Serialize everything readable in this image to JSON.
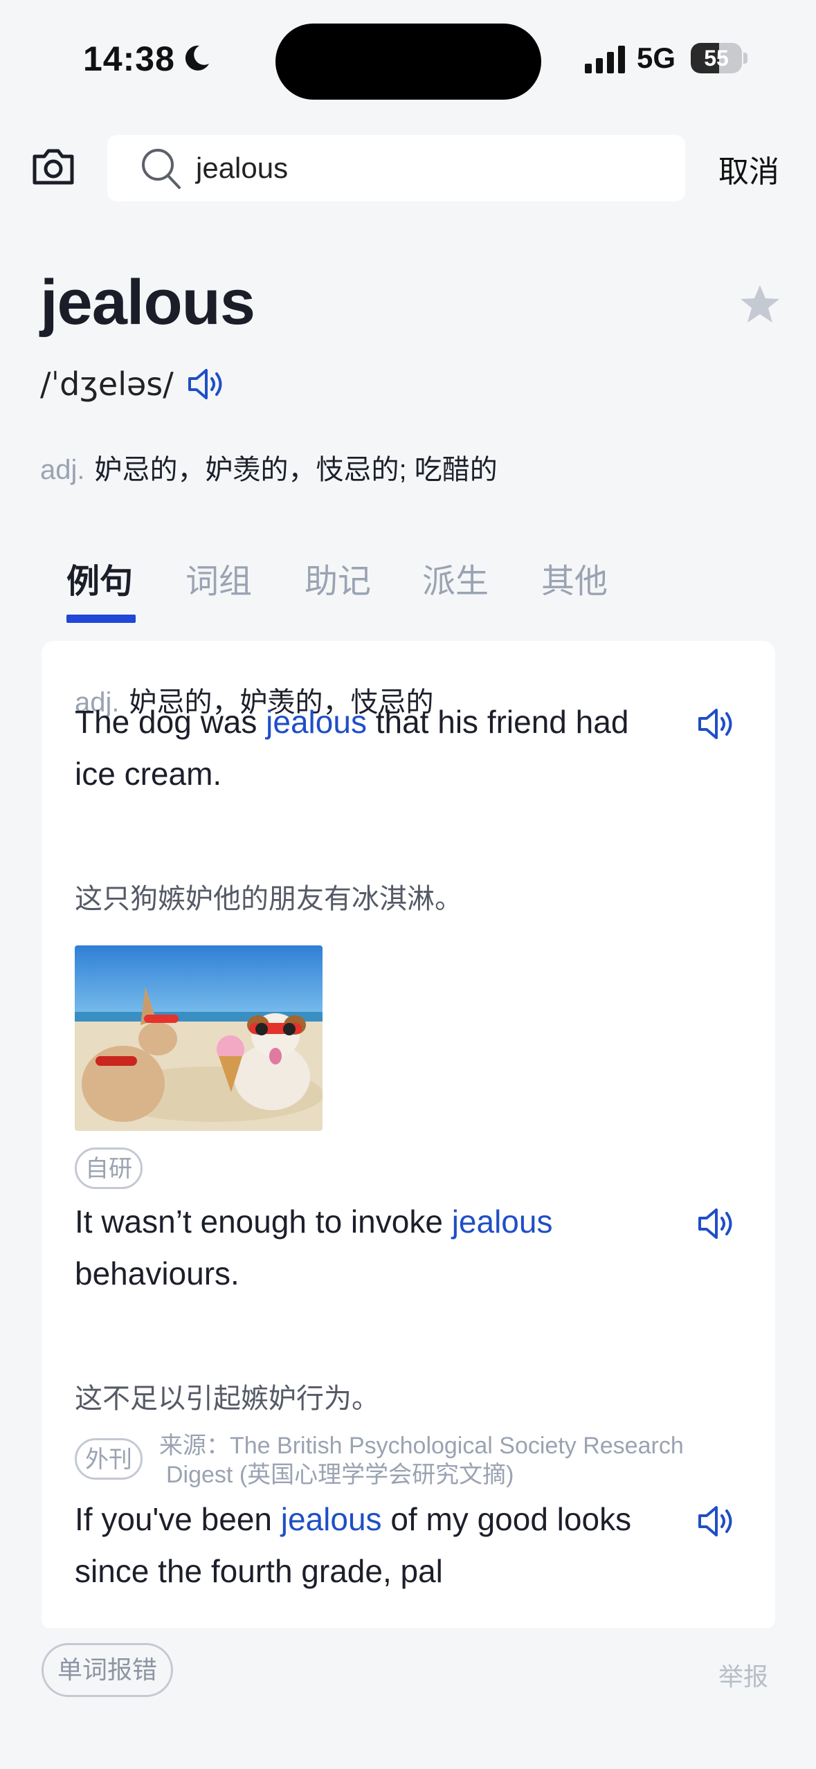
{
  "status_bar": {
    "time": "14:38",
    "network": "5G",
    "battery_level": "55",
    "battery_fraction": 0.55
  },
  "search": {
    "query": "jealous",
    "cancel_label": "取消"
  },
  "word": {
    "headword": "jealous",
    "phonetic": "/ˈdʒeləs/",
    "pos": "adj.",
    "definition": "妒忌的，妒羡的，忮忌的; 吃醋的"
  },
  "tabs": [
    {
      "label": "例句",
      "active": true
    },
    {
      "label": "词组",
      "active": false
    },
    {
      "label": "助记",
      "active": false
    },
    {
      "label": "派生",
      "active": false
    },
    {
      "label": "其他",
      "active": false
    }
  ],
  "examples_card": {
    "pos": "adj.",
    "definition": "妒忌的，妒羡的，忮忌的",
    "examples": [
      {
        "line1_before": "The dog was ",
        "highlight": "jealous",
        "line1_after": " that his friend had",
        "line2": "ice cream.",
        "translation": "这只狗嫉妒他的朋友有冰淇淋。",
        "tag": "自研"
      },
      {
        "line1_before": "It wasn’t enough to invoke ",
        "highlight": "jealous",
        "line1_after": "",
        "line2": "behaviours.",
        "translation": "这不足以引起嫉妒行为。",
        "tag": "外刊",
        "source_line1": "来源：The British Psychological Society Research",
        "source_line2": "Digest (英国心理学学会研究文摘)"
      },
      {
        "line1_before": "If you've been ",
        "highlight": "jealous",
        "line1_after": " of my good looks",
        "line2": "since the fourth grade, pal"
      }
    ]
  },
  "bottom_bar": {
    "report_error_label": "单词报错",
    "report_label": "举报"
  },
  "colors": {
    "accent": "#2047d6",
    "highlight": "#1f4fc6",
    "muted": "#9aa3b2",
    "background": "#f5f6f8"
  }
}
